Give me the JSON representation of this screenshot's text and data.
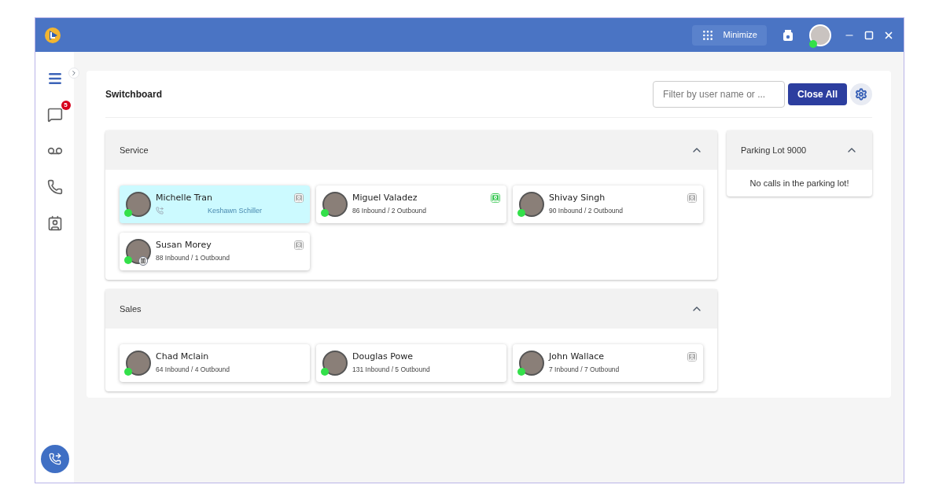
{
  "titlebar": {
    "dialpad_button": "Minimize",
    "user_online": true
  },
  "sidebar": {
    "items": [
      {
        "kind": "menu",
        "selected": true
      },
      {
        "kind": "chat",
        "selected": false,
        "badge": "5"
      },
      {
        "kind": "voicemail",
        "selected": false
      },
      {
        "kind": "phone",
        "selected": false
      },
      {
        "kind": "contacts",
        "selected": false
      }
    ]
  },
  "page": {
    "title": "Switchboard",
    "filter": {
      "placeholder": "Filter by user name or ..."
    },
    "close_all": "Close All"
  },
  "groups": [
    {
      "name": "Service",
      "expanded": true,
      "users": [
        {
          "name": "Michelle Tran",
          "online": true,
          "selected": true,
          "call_with": "Keshawn Schiller",
          "has_contact": true,
          "contact_active": false,
          "on_hold": false
        },
        {
          "name": "Miguel Valadez",
          "online": true,
          "selected": false,
          "stats": "86 Inbound / 2 Outbound",
          "has_contact": true,
          "contact_active": true,
          "on_hold": false
        },
        {
          "name": "Shivay Singh",
          "online": true,
          "selected": false,
          "stats": "90 Inbound / 2 Outbound",
          "has_contact": true,
          "contact_active": false,
          "on_hold": false
        },
        {
          "name": "Susan Morey",
          "online": true,
          "selected": false,
          "stats": "88 Inbound / 1 Outbound",
          "has_contact": true,
          "contact_active": false,
          "on_hold": true
        }
      ]
    },
    {
      "name": "Sales",
      "expanded": true,
      "users": [
        {
          "name": "Chad Mclain",
          "online": true,
          "selected": false,
          "stats": "64 Inbound / 4 Outbound",
          "has_contact": false,
          "on_hold": false
        },
        {
          "name": "Douglas Powe",
          "online": true,
          "selected": false,
          "stats": "131 Inbound / 5 Outbound",
          "has_contact": false,
          "on_hold": false
        },
        {
          "name": "John Wallace",
          "online": true,
          "selected": false,
          "stats": "7 Inbound / 7 Outbound",
          "has_contact": true,
          "contact_active": false,
          "on_hold": false
        }
      ]
    }
  ],
  "parking_lot": {
    "title": "Parking Lot 9000",
    "expanded": true,
    "message": "No calls in the parking lot!"
  }
}
